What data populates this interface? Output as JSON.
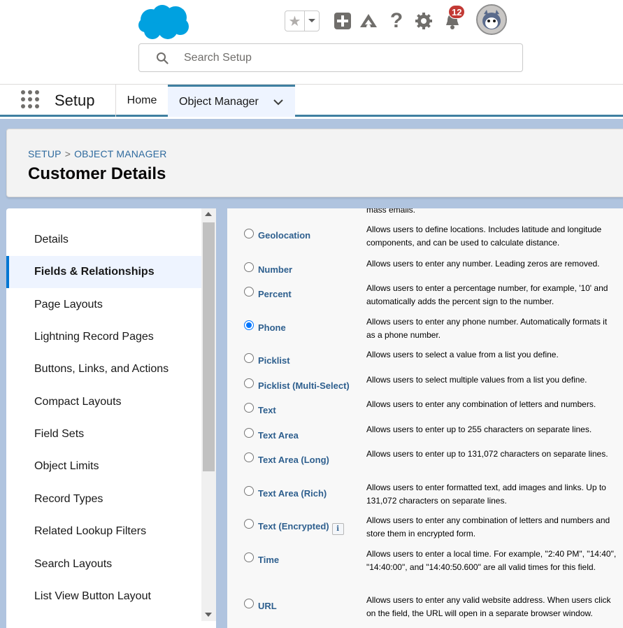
{
  "header": {
    "search_placeholder": "Search Setup",
    "notification_count": "12",
    "icons": [
      "salesforce-logo",
      "star-icon",
      "chevron-down-icon",
      "add-icon",
      "trailhead-icon",
      "help-icon",
      "gear-icon",
      "bell-icon",
      "avatar"
    ]
  },
  "context_bar": {
    "app_name": "Setup",
    "tabs": [
      {
        "label": "Home"
      },
      {
        "label": "Object Manager"
      }
    ]
  },
  "page_header": {
    "breadcrumb_1": "SETUP",
    "breadcrumb_sep": ">",
    "breadcrumb_2": "OBJECT MANAGER",
    "title": "Customer Details"
  },
  "left_nav": {
    "items": [
      {
        "label": "Details"
      },
      {
        "label": "Fields & Relationships"
      },
      {
        "label": "Page Layouts"
      },
      {
        "label": "Lightning Record Pages"
      },
      {
        "label": "Buttons, Links, and Actions"
      },
      {
        "label": "Compact Layouts"
      },
      {
        "label": "Field Sets"
      },
      {
        "label": "Object Limits"
      },
      {
        "label": "Record Types"
      },
      {
        "label": "Related Lookup Filters"
      },
      {
        "label": "Search Layouts"
      },
      {
        "label": "List View Button Layout"
      }
    ],
    "active": "Fields & Relationships"
  },
  "field_types": {
    "top_fragment": "mass emails.",
    "selected": "Phone",
    "rows": [
      {
        "label": "Geolocation",
        "desc": "Allows users to define locations. Includes latitude and longitude components, and can be used to calculate distance."
      },
      {
        "label": "Number",
        "desc": "Allows users to enter any number. Leading zeros are removed."
      },
      {
        "label": "Percent",
        "desc": "Allows users to enter a percentage number, for example, '10' and automatically adds the percent sign to the number."
      },
      {
        "label": "Phone",
        "desc": "Allows users to enter any phone number. Automatically formats it as a phone number."
      },
      {
        "label": "Picklist",
        "desc": "Allows users to select a value from a list you define."
      },
      {
        "label": "Picklist (Multi-Select)",
        "desc": "Allows users to select multiple values from a list you define."
      },
      {
        "label": "Text",
        "desc": "Allows users to enter any combination of letters and numbers."
      },
      {
        "label": "Text Area",
        "desc": "Allows users to enter up to 255 characters on separate lines."
      },
      {
        "label": "Text Area (Long)",
        "desc": "Allows users to enter up to 131,072 characters on separate lines."
      },
      {
        "label": "Text Area (Rich)",
        "desc": "Allows users to enter formatted text, add images and links. Up to 131,072 characters on separate lines."
      },
      {
        "label": "Text (Encrypted)",
        "desc": "Allows users to enter any combination of letters and numbers and store them in encrypted form.",
        "info_icon": "i"
      },
      {
        "label": "Time",
        "desc": "Allows users to enter a local time. For example, \"2:40 PM\", \"14:40\", \"14:40:00\", and \"14:40:50.600\" are all valid times for this field."
      },
      {
        "label": "URL",
        "desc": "Allows users to enter any valid website address. When users click on the field, the URL will open in a separate browser window."
      }
    ]
  },
  "colors": {
    "brand_blue": "#0176d3",
    "link_blue": "#2e5f8e",
    "context_accent": "#3e7fa0",
    "background": "#b0c4df",
    "badge_red": "#c23934"
  }
}
